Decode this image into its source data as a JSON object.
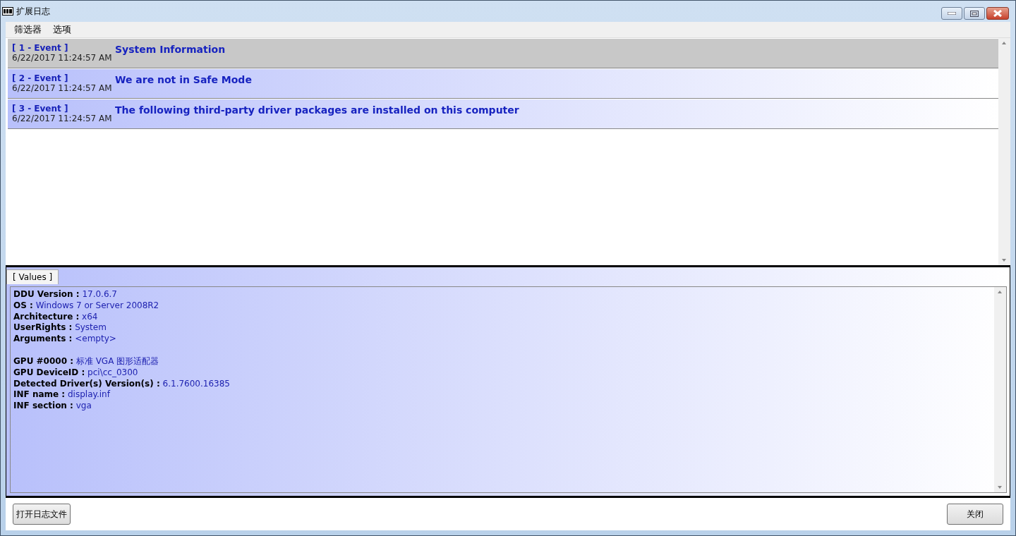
{
  "window": {
    "title": "扩展日志"
  },
  "menu": [
    "筛选器",
    "选项"
  ],
  "events": [
    {
      "tag": "[ 1 - Event ]",
      "time": "6/22/2017 11:24:57 AM",
      "message": "System Information",
      "selected": true
    },
    {
      "tag": "[ 2 - Event ]",
      "time": "6/22/2017 11:24:57 AM",
      "message": "We are not in Safe Mode",
      "selected": false
    },
    {
      "tag": "[ 3 - Event ]",
      "time": "6/22/2017 11:24:57 AM",
      "message": "The following third-party driver packages are installed on this computer",
      "selected": false
    }
  ],
  "tabs": [
    {
      "label": "[ Values ]",
      "selected": true
    }
  ],
  "value_groups": [
    [
      {
        "key": "DDU Version :",
        "value": "17.0.6.7"
      },
      {
        "key": "OS :",
        "value": "Windows 7 or Server 2008R2"
      },
      {
        "key": "Architecture :",
        "value": "x64"
      },
      {
        "key": "UserRights :",
        "value": "System"
      },
      {
        "key": "Arguments :",
        "value": "<empty>"
      }
    ],
    [
      {
        "key": "GPU #0000 :",
        "value": "标准 VGA 图形适配器"
      },
      {
        "key": "GPU DeviceID :",
        "value": "pci\\cc_0300"
      },
      {
        "key": "Detected Driver(s) Version(s) :",
        "value": "6.1.7600.16385"
      },
      {
        "key": "INF name :",
        "value": "display.inf"
      },
      {
        "key": "INF section :",
        "value": "vga"
      }
    ]
  ],
  "buttons": {
    "left": "打开日志文件",
    "right": "关闭"
  }
}
